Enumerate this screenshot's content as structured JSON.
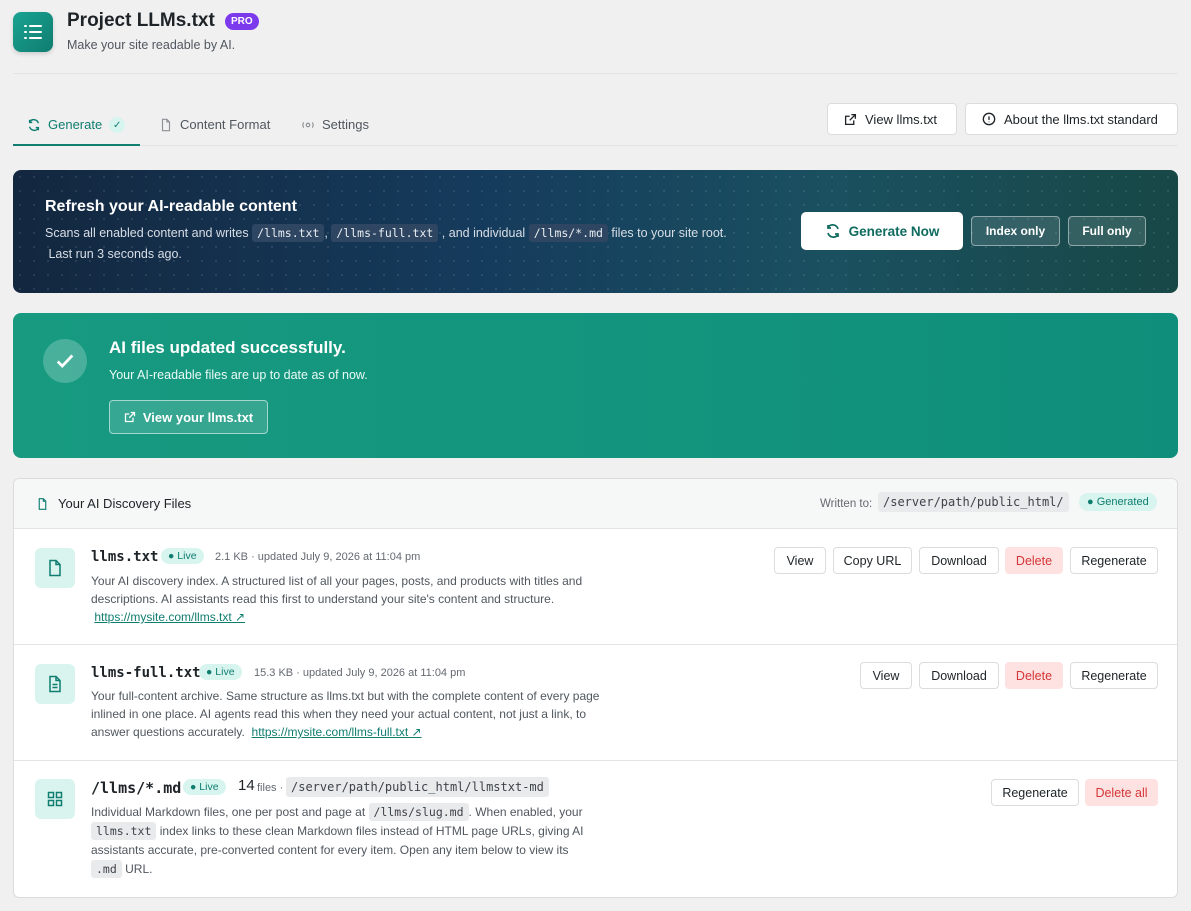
{
  "header": {
    "title": "Project LLMs.txt",
    "badge": "PRO",
    "subtitle": "Make your site readable by AI."
  },
  "tabs": [
    {
      "label": "Generate",
      "check": "✓",
      "active": true
    },
    {
      "label": "Content Format",
      "active": false
    },
    {
      "label": "Settings",
      "active": false
    }
  ],
  "top_actions": {
    "view_llms": "View llms.txt",
    "about": "About the llms.txt standard"
  },
  "hero": {
    "title": "Refresh your AI-readable content",
    "desc_1": "Scans all enabled content and writes",
    "code_1": "/llms.txt",
    "sep_1": ",",
    "code_2": "/llms-full.txt",
    "desc_2": ", and individual",
    "code_3": "/llms/*.md",
    "desc_3": "files to your site root.",
    "last_run": "Last run 3 seconds ago.",
    "generate_now": "Generate Now",
    "index_only": "Index only",
    "full_only": "Full only"
  },
  "success": {
    "title": "AI files updated successfully.",
    "message": "Your AI-readable files are up to date as of now.",
    "button": "View your llms.txt"
  },
  "files_panel": {
    "title": "Your AI Discovery Files",
    "written_to_label": "Written to:",
    "path": "/server/path/public_html/",
    "status": "Generated",
    "items": [
      {
        "name": "llms.txt",
        "status": "Live",
        "meta": "2.1 KB · updated July 9, 2026 at 11:04 pm",
        "description": "Your AI discovery index. A structured list of all your pages, posts, and products with titles and descriptions. AI assistants read this first to understand your site's content and structure.",
        "link": "https://mysite.com/llms.txt ↗",
        "actions": [
          "View",
          "Copy URL",
          "Download",
          "Delete",
          "Regenerate"
        ]
      },
      {
        "name": "llms-full.txt",
        "status": "Live",
        "meta": "15.3 KB · updated July 9, 2026 at 11:04 pm",
        "description": "Your full-content archive. Same structure as llms.txt but with the complete content of every page inlined in one place. AI agents read this when they need your actual content, not just a link, to answer questions accurately.",
        "link": "https://mysite.com/llms-full.txt ↗",
        "actions": [
          "View",
          "Download",
          "Delete",
          "Regenerate"
        ]
      },
      {
        "name": "/llms/*.md",
        "status": "Live",
        "count": "14",
        "count_label": "files ·",
        "path": "/server/path/public_html/llmstxt-md",
        "desc_1": "Individual Markdown files, one per post and page at",
        "code_1": "/llms/slug.md",
        "desc_2": ". When enabled, your",
        "code_2": "llms.txt",
        "desc_3": "index links to these clean Markdown files instead of HTML page URLs, giving AI assistants accurate, pre-converted content for every item.  Open any item below to view its",
        "code_3": ".md",
        "desc_4": "URL.",
        "actions": [
          "Regenerate",
          "Delete all"
        ]
      }
    ]
  },
  "icons": [
    "list-icon",
    "refresh-icon",
    "document-icon",
    "gear-icon",
    "external-link-icon",
    "info-icon",
    "check-icon",
    "grid-icon"
  ],
  "colors": {
    "accent": "#0f7d70",
    "pro": "#7c3aed",
    "danger": "#d63638",
    "hero_dark": "#13273f",
    "success": "#179a80"
  }
}
